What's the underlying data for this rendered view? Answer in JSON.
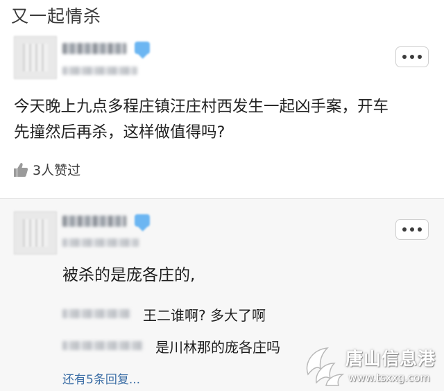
{
  "page": {
    "title": "又一起情杀"
  },
  "post": {
    "text_line1": "今天晚上九点多程庄镇汪庄村西发生一起凶手案，开车",
    "text_line2": "先撞然后再杀，这样做值得吗?",
    "likes_label": "3人赞过",
    "more_icon": "ellipsis-icon",
    "like_icon": "thumbs-up-icon"
  },
  "comment": {
    "text": "被杀的是庞各庄的,",
    "replies": [
      {
        "text": "王二谁啊? 多大了啊"
      },
      {
        "text": "是川林那的庞各庄吗"
      }
    ],
    "more_replies": "还有5条回复..."
  },
  "watermark": {
    "title": "唐山信息港",
    "url": "www.tsxxg.com"
  },
  "colors": {
    "link": "#3d6fa6",
    "badge": "#6cb6f2",
    "panel": "#f7f7f7"
  }
}
